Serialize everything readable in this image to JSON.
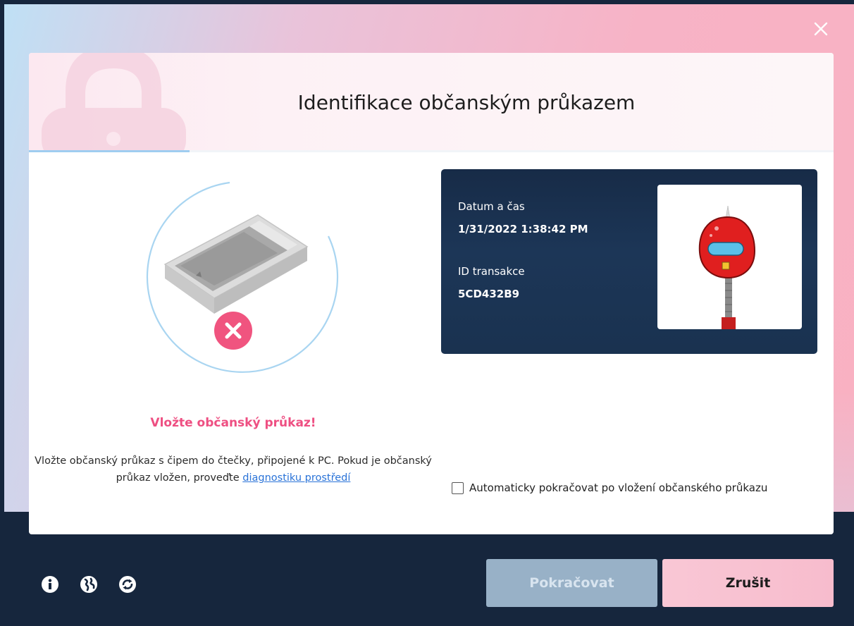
{
  "dialog": {
    "title": "Identifikace občanským průkazem",
    "progress_fraction": 0.2
  },
  "status": {
    "title": "Vložte občanský průkaz!",
    "instructions_text": "Vložte občanský průkaz s čipem do čtečky, připojené k PC. Pokud je občanský průkaz vložen, proveďte ",
    "instructions_link": "diagnostiku prostředí"
  },
  "info_panel": {
    "datetime_label": "Datum a čas",
    "datetime_value": "1/31/2022 1:38:42 PM",
    "transaction_label": "ID transakce",
    "transaction_value": "5CD432B9"
  },
  "auto_continue": {
    "label": "Automaticky pokračovat po vložení občanského průkazu",
    "checked": false
  },
  "buttons": {
    "continue_label": "Pokračovat",
    "cancel_label": "Zrušit"
  },
  "icons": [
    "close-icon",
    "info-icon",
    "globe-icon",
    "sync-icon",
    "error-x-icon",
    "lock-icon"
  ],
  "colors": {
    "accent_pink": "#ee4f82",
    "dark_navy": "#16263d",
    "link_blue": "#2a73d8",
    "progress_blue": "#9fcdf0"
  }
}
